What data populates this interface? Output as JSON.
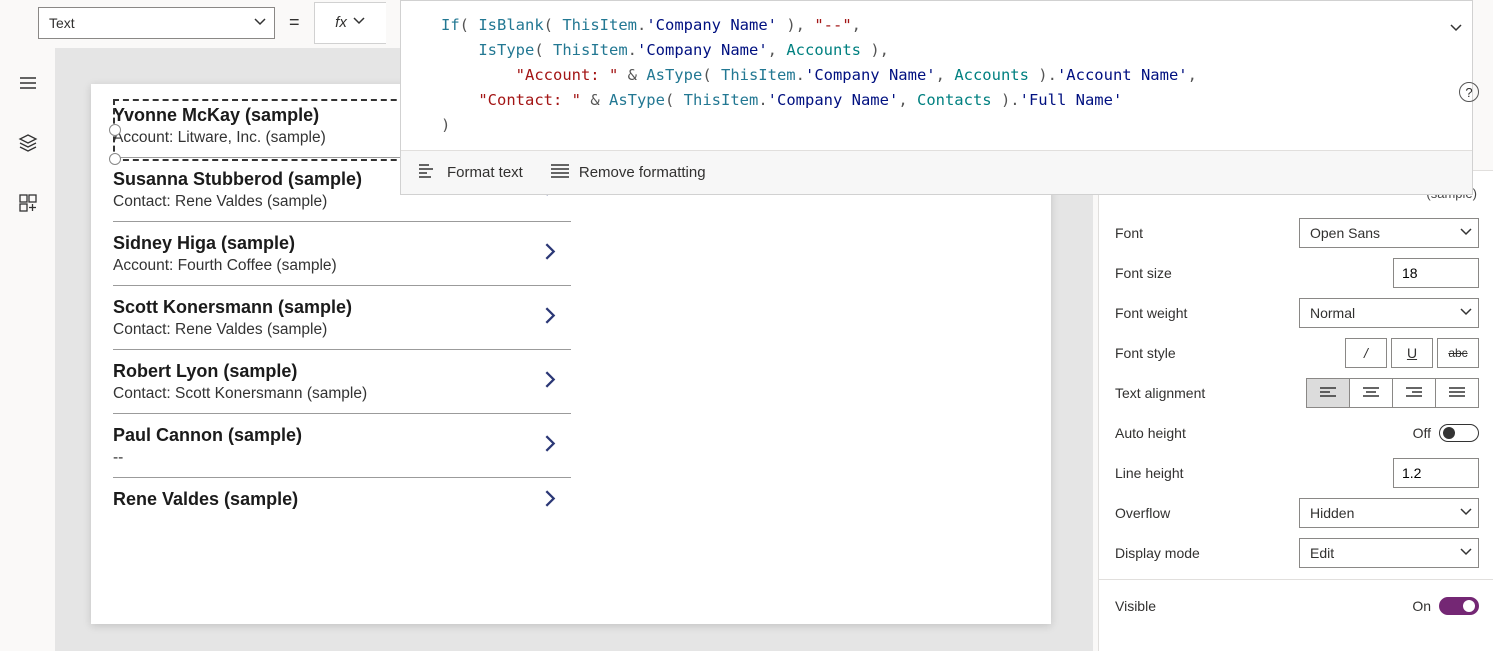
{
  "propertyDropdown": "Text",
  "formula": {
    "tokens": [
      [
        {
          "t": "fn",
          "v": "If"
        },
        {
          "t": "p",
          "v": "( "
        },
        {
          "t": "fn",
          "v": "IsBlank"
        },
        {
          "t": "p",
          "v": "( "
        },
        {
          "t": "ref",
          "v": "ThisItem"
        },
        {
          "t": "p",
          "v": "."
        },
        {
          "t": "col",
          "v": "'Company Name'"
        },
        {
          "t": "p",
          "v": " ), "
        },
        {
          "t": "str",
          "v": "\"--\""
        },
        {
          "t": "p",
          "v": ","
        }
      ],
      [
        {
          "t": "pad",
          "v": "    "
        },
        {
          "t": "fn",
          "v": "IsType"
        },
        {
          "t": "p",
          "v": "( "
        },
        {
          "t": "ref",
          "v": "ThisItem"
        },
        {
          "t": "p",
          "v": "."
        },
        {
          "t": "col",
          "v": "'Company Name'"
        },
        {
          "t": "p",
          "v": ", "
        },
        {
          "t": "ent",
          "v": "Accounts"
        },
        {
          "t": "p",
          "v": " ),"
        }
      ],
      [
        {
          "t": "pad",
          "v": "        "
        },
        {
          "t": "str",
          "v": "\"Account: \""
        },
        {
          "t": "p",
          "v": " & "
        },
        {
          "t": "fn",
          "v": "AsType"
        },
        {
          "t": "p",
          "v": "( "
        },
        {
          "t": "ref",
          "v": "ThisItem"
        },
        {
          "t": "p",
          "v": "."
        },
        {
          "t": "col",
          "v": "'Company Name'"
        },
        {
          "t": "p",
          "v": ", "
        },
        {
          "t": "ent",
          "v": "Accounts"
        },
        {
          "t": "p",
          "v": " )."
        },
        {
          "t": "col",
          "v": "'Account Name'"
        },
        {
          "t": "p",
          "v": ","
        }
      ],
      [
        {
          "t": "pad",
          "v": "    "
        },
        {
          "t": "str",
          "v": "\"Contact: \""
        },
        {
          "t": "p",
          "v": " & "
        },
        {
          "t": "fn",
          "v": "AsType"
        },
        {
          "t": "p",
          "v": "( "
        },
        {
          "t": "ref",
          "v": "ThisItem"
        },
        {
          "t": "p",
          "v": "."
        },
        {
          "t": "col",
          "v": "'Company Name'"
        },
        {
          "t": "p",
          "v": ", "
        },
        {
          "t": "ent",
          "v": "Contacts"
        },
        {
          "t": "p",
          "v": " )."
        },
        {
          "t": "col",
          "v": "'Full Name'"
        }
      ],
      [
        {
          "t": "p",
          "v": ")"
        }
      ]
    ],
    "formatText": "Format text",
    "removeFormatting": "Remove formatting"
  },
  "fxLabel": "fx",
  "list": [
    {
      "title": "Yvonne McKay (sample)",
      "sub": "Account: Litware, Inc. (sample)"
    },
    {
      "title": "Susanna Stubberod (sample)",
      "sub": "Contact: Rene Valdes (sample)"
    },
    {
      "title": "Sidney Higa (sample)",
      "sub": "Account: Fourth Coffee (sample)"
    },
    {
      "title": "Scott Konersmann (sample)",
      "sub": "Contact: Rene Valdes (sample)"
    },
    {
      "title": "Robert Lyon (sample)",
      "sub": "Contact: Scott Konersmann (sample)"
    },
    {
      "title": "Paul Cannon (sample)",
      "sub": "--"
    },
    {
      "title": "Rene Valdes (sample)",
      "sub": ""
    }
  ],
  "props": {
    "textValue": "(sample)",
    "fontLabel": "Font",
    "font": "Open Sans",
    "fontSizeLabel": "Font size",
    "fontSize": "18",
    "fontWeightLabel": "Font weight",
    "fontWeight": "Normal",
    "fontStyleLabel": "Font style",
    "italicGlyph": "/",
    "underlineGlyph": "U",
    "strikeGlyph": "abc",
    "textAlignLabel": "Text alignment",
    "autoHeightLabel": "Auto height",
    "autoHeightVal": "Off",
    "lineHeightLabel": "Line height",
    "lineHeight": "1.2",
    "overflowLabel": "Overflow",
    "overflow": "Hidden",
    "displayModeLabel": "Display mode",
    "displayMode": "Edit",
    "visibleLabel": "Visible",
    "visibleVal": "On"
  }
}
